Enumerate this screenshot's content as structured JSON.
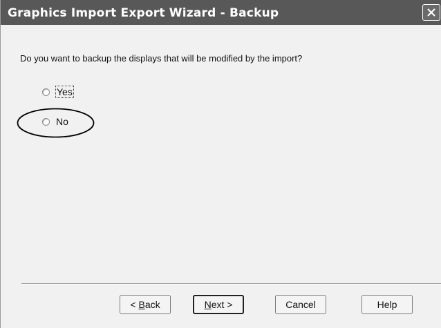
{
  "window": {
    "title": "Graphics Import Export Wizard - Backup"
  },
  "content": {
    "question": "Do you want to backup the displays that will be modified by the import?",
    "options": [
      {
        "label": "Yes",
        "selected": false,
        "focused": true
      },
      {
        "label": "No",
        "selected": false,
        "highlighted": true
      }
    ]
  },
  "buttons": {
    "back_mnemonic": "B",
    "back_rest": "ack",
    "back_prefix": "< ",
    "next_mnemonic": "N",
    "next_rest": "ext >",
    "cancel": "Cancel",
    "help": "Help"
  },
  "icons": {
    "close": "close-icon"
  }
}
